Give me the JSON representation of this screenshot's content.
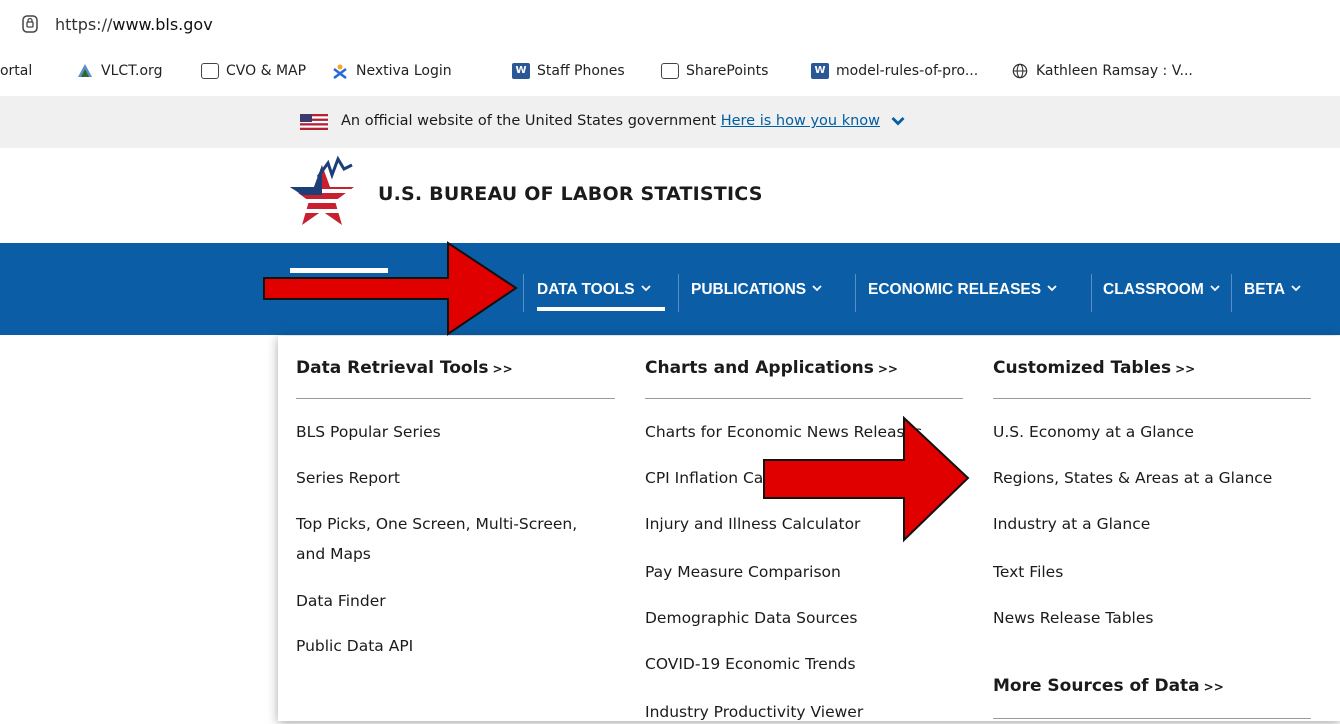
{
  "browser": {
    "url_prefix": "https://",
    "url_domain": "www.bls.gov",
    "bookmarks": [
      {
        "label": "Portal",
        "icon": "none"
      },
      {
        "label": "VLCT.org",
        "icon": "vlct-logo-icon"
      },
      {
        "label": "CVO & MAP",
        "icon": "folder-icon"
      },
      {
        "label": "Nextiva Login",
        "icon": "nextiva-icon"
      },
      {
        "label": "Staff Phones",
        "icon": "word-icon"
      },
      {
        "label": "SharePoints",
        "icon": "folder-icon"
      },
      {
        "label": "model-rules-of-pro...",
        "icon": "word-icon"
      },
      {
        "label": "Kathleen Ramsay : V...",
        "icon": "globe-icon"
      }
    ]
  },
  "gov_banner": {
    "text": "An official website of the United States government",
    "link": "Here is how you know"
  },
  "header": {
    "agency_name": "U.S. BUREAU OF LABOR STATISTICS"
  },
  "nav": {
    "items": [
      {
        "label": "DATA TOOLS"
      },
      {
        "label": "PUBLICATIONS"
      },
      {
        "label": "ECONOMIC RELEASES"
      },
      {
        "label": "CLASSROOM"
      },
      {
        "label": "BETA"
      }
    ]
  },
  "dropdown": {
    "columns": [
      {
        "heading": "Data Retrieval Tools",
        "heading_suffix": ">>",
        "links": [
          "BLS Popular Series",
          "Series Report",
          "Top Picks, One Screen, Multi-Screen,",
          "and Maps",
          "Data Finder",
          "Public Data API"
        ]
      },
      {
        "heading": "Charts and Applications",
        "heading_suffix": ">>",
        "links": [
          "Charts for Economic News Releases",
          "CPI Inflation Ca",
          "Injury and Illness Calculator",
          "Pay Measure Comparison",
          "Demographic Data Sources",
          "COVID-19 Economic Trends",
          "Industry Productivity Viewer"
        ]
      },
      {
        "heading": "Customized Tables",
        "heading_suffix": ">>",
        "links": [
          "U.S. Economy at a Glance",
          "Regions, States & Areas at a Glance",
          "Industry at a Glance",
          "Text Files",
          "News Release Tables"
        ],
        "subheading": "More Sources of Data",
        "subheading_suffix": ">>"
      }
    ]
  },
  "annotation_colors": {
    "arrow": "#e00000",
    "nav_bg": "#0b5ea6"
  }
}
